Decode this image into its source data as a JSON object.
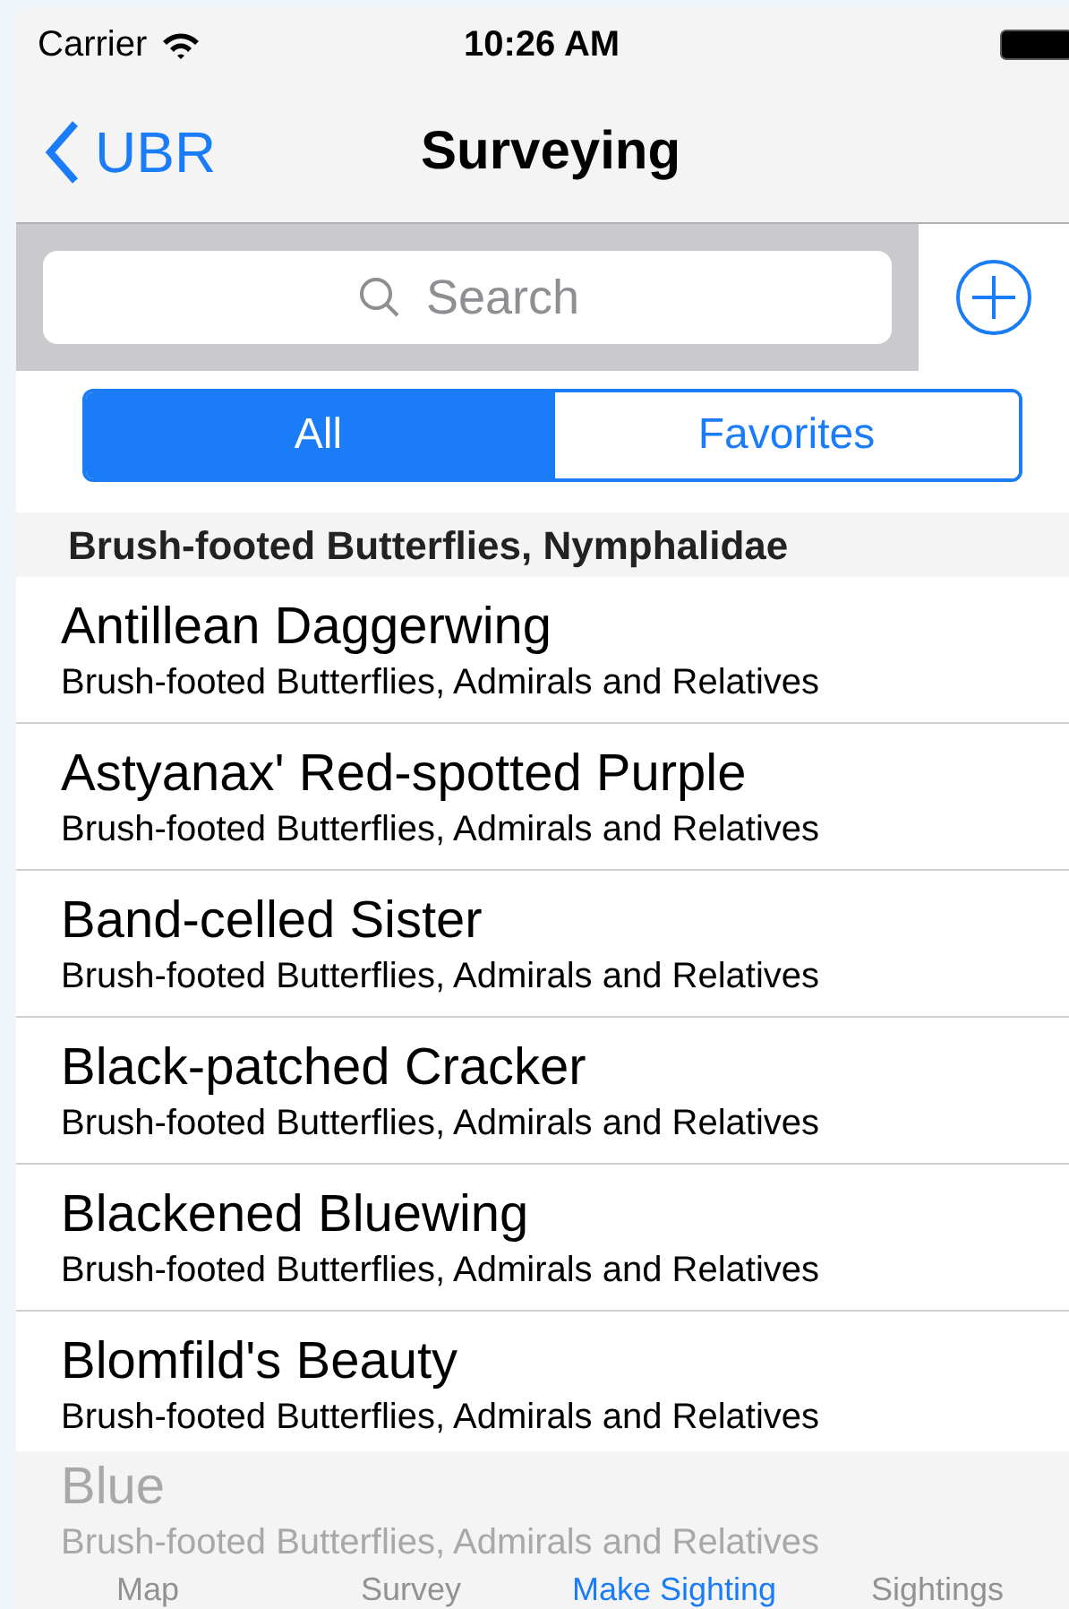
{
  "status_bar": {
    "carrier": "Carrier",
    "time": "10:26 AM"
  },
  "nav": {
    "back": "UBR",
    "title": "Surveying"
  },
  "search": {
    "placeholder": "Search"
  },
  "segments": [
    {
      "label": "All",
      "selected": true
    },
    {
      "label": "Favorites",
      "selected": false
    }
  ],
  "section": {
    "title": "Brush-footed Butterflies, Nymphalidae"
  },
  "rows": [
    {
      "title": "Antillean Daggerwing",
      "subtitle": "Brush-footed Butterflies, Admirals and Relatives"
    },
    {
      "title": "Astyanax' Red-spotted Purple",
      "subtitle": "Brush-footed Butterflies, Admirals and Relatives"
    },
    {
      "title": "Band-celled Sister",
      "subtitle": "Brush-footed Butterflies, Admirals and Relatives"
    },
    {
      "title": "Black-patched Cracker",
      "subtitle": "Brush-footed Butterflies, Admirals and Relatives"
    },
    {
      "title": "Blackened Bluewing",
      "subtitle": "Brush-footed Butterflies, Admirals and Relatives"
    },
    {
      "title": "Blomfild's Beauty",
      "subtitle": "Brush-footed Butterflies, Admirals and Relatives"
    }
  ],
  "behind_tab_bar": {
    "title": "Blue",
    "subtitle": "Brush-footed Butterflies, Admirals and Relatives"
  },
  "tabs": [
    {
      "label": "Map",
      "selected": false
    },
    {
      "label": "Survey",
      "selected": false
    },
    {
      "label": "Make Sighting",
      "selected": true
    },
    {
      "label": "Sightings",
      "selected": false
    }
  ]
}
